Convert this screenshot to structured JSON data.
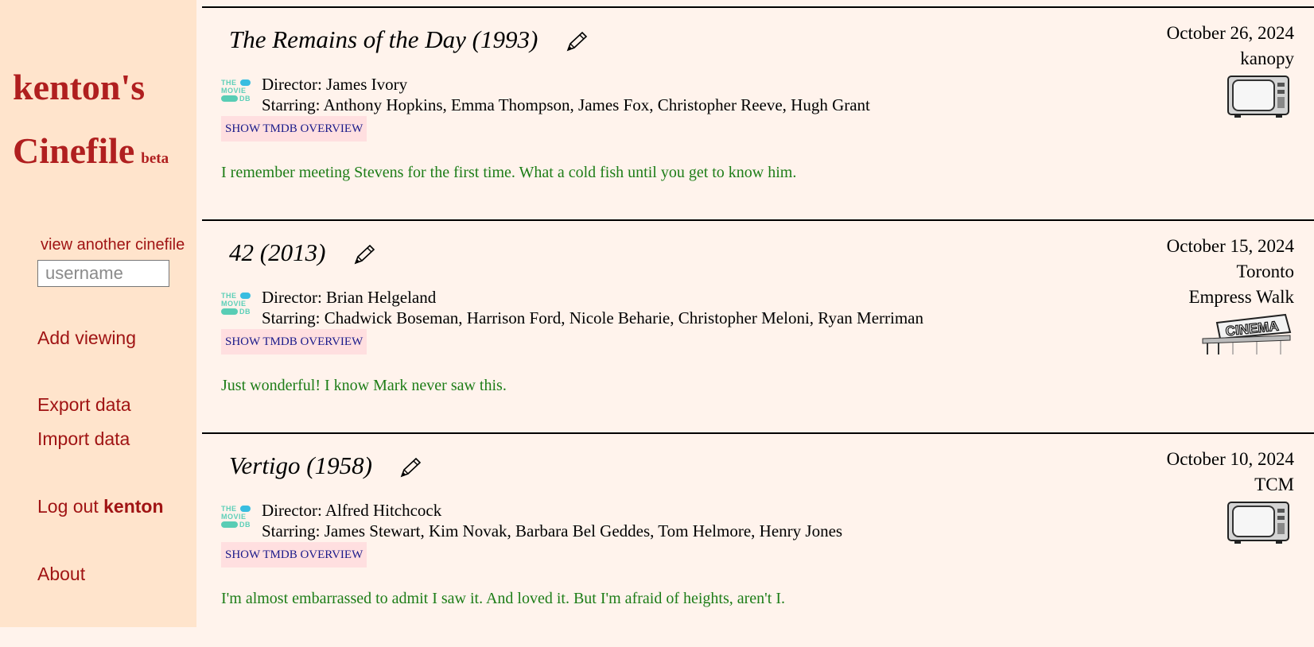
{
  "sidebar": {
    "logo_line1": "kenton's",
    "logo_line2": "Cinefile",
    "logo_beta": "beta",
    "view_another_label": "view another cinefile",
    "username_placeholder": "username",
    "add_viewing": "Add viewing",
    "export_data": "Export data",
    "import_data": "Import data",
    "log_out_prefix": "Log out",
    "log_out_user": "kenton",
    "about": "About"
  },
  "entries": [
    {
      "title": "The Remains of the Day (1993)",
      "director": "Director: James Ivory",
      "starring": "Starring: Anthony Hopkins, Emma Thompson, James Fox, Christopher Reeve, Hugh Grant",
      "overview_button": "SHOW TMDB OVERVIEW",
      "comment": "I remember meeting Stevens for the first time. What a cold fish until you get to know him.",
      "date": "October 26, 2024",
      "location_lines": [
        "kanopy"
      ],
      "venue_icon": "tv-icon"
    },
    {
      "title": "42 (2013)",
      "director": "Director: Brian Helgeland",
      "starring": "Starring: Chadwick Boseman, Harrison Ford, Nicole Beharie, Christopher Meloni, Ryan Merriman",
      "overview_button": "SHOW TMDB OVERVIEW",
      "comment": "Just wonderful! I know Mark never saw this.",
      "date": "October 15, 2024",
      "location_lines": [
        "Toronto",
        "Empress Walk"
      ],
      "venue_icon": "cinema-icon"
    },
    {
      "title": "Vertigo (1958)",
      "director": "Director: Alfred Hitchcock",
      "starring": "Starring: James Stewart, Kim Novak, Barbara Bel Geddes, Tom Helmore, Henry Jones",
      "overview_button": "SHOW TMDB OVERVIEW",
      "comment": "I'm almost embarrassed to admit I saw it. And loved it. But I'm afraid of heights, aren't I.",
      "date": "October 10, 2024",
      "location_lines": [
        "TCM"
      ],
      "venue_icon": "tv-icon"
    }
  ],
  "tmdb_logo": {
    "line1": "THE",
    "line2": "MOVIE",
    "line3": "DB"
  },
  "colors": {
    "sidebar_bg": "#ffe4cc",
    "main_bg": "#fff3ec",
    "brand_red": "#b01f1f",
    "comment_green": "#1d7d17",
    "overview_btn_bg": "#ffdfe0"
  }
}
